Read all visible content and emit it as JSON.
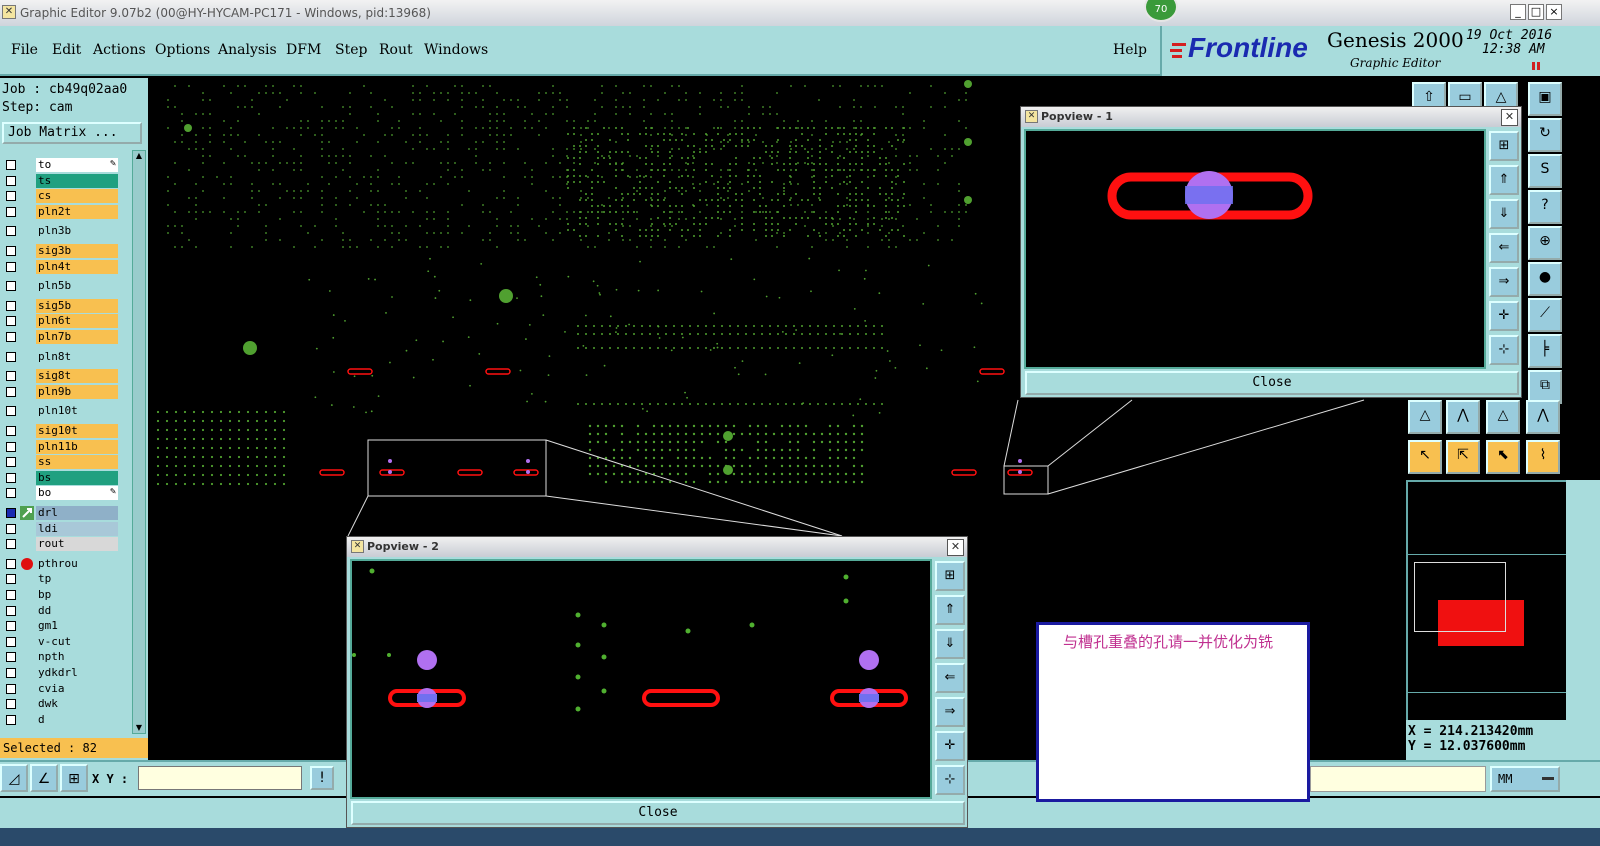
{
  "window": {
    "title": "Graphic Editor 9.07b2 (00@HY-HYCAM-PC171 - Windows, pid:13968)",
    "badge": "70",
    "minimize": "_",
    "maximize": "□",
    "close": "×"
  },
  "menu": {
    "items": [
      "File",
      "Edit",
      "Actions",
      "Options",
      "Analysis",
      "DFM",
      "Step",
      "Rout",
      "Windows"
    ],
    "help": "Help"
  },
  "brand": {
    "logo": "Frontline",
    "product": "Genesis 2000",
    "subtitle": "Graphic Editor",
    "date": "19 Oct 2016",
    "time": "12:38 AM"
  },
  "job": {
    "job_line": "Job : cb49q02aa0",
    "step_line": "Step: cam",
    "matrix_button": "Job Matrix ..."
  },
  "layers": [
    {
      "name": "to",
      "color": "#ffffff",
      "mark": "✎"
    },
    {
      "name": "ts",
      "color": "#20a080"
    },
    {
      "name": "cs",
      "color": "#f8c050"
    },
    {
      "name": "pln2t",
      "color": "#f8c050"
    },
    {
      "name": "pln3b",
      "color": "#a8dcdc"
    },
    {
      "name": "sig3b",
      "color": "#f8c050"
    },
    {
      "name": "pln4t",
      "color": "#f8c050"
    },
    {
      "name": "pln5b",
      "color": "#a8dcdc"
    },
    {
      "name": "sig5b",
      "color": "#f8c050"
    },
    {
      "name": "pln6t",
      "color": "#f8c050"
    },
    {
      "name": "pln7b",
      "color": "#f8c050"
    },
    {
      "name": "pln8t",
      "color": "#a8dcdc"
    },
    {
      "name": "sig8t",
      "color": "#f8c050"
    },
    {
      "name": "pln9b",
      "color": "#f8c050"
    },
    {
      "name": "pln10t",
      "color": "#a8dcdc"
    },
    {
      "name": "sig10t",
      "color": "#f8c050"
    },
    {
      "name": "pln11b",
      "color": "#f8c050"
    },
    {
      "name": "ss",
      "color": "#f8c050"
    },
    {
      "name": "bs",
      "color": "#20a080"
    },
    {
      "name": "bo",
      "color": "#ffffff",
      "mark": "✎"
    },
    {
      "name": "drl",
      "color": "#8fb0c8"
    },
    {
      "name": "ldi",
      "color": "#a8c8d8"
    },
    {
      "name": "rout",
      "color": "#d8d8d8"
    },
    {
      "name": "pthrou",
      "color": "#a8dcdc"
    },
    {
      "name": "tp",
      "color": "#a8dcdc"
    },
    {
      "name": "bp",
      "color": "#a8dcdc"
    },
    {
      "name": "dd",
      "color": "#a8dcdc"
    },
    {
      "name": "gm1",
      "color": "#a8dcdc"
    },
    {
      "name": "v-cut",
      "color": "#a8dcdc"
    },
    {
      "name": "npth",
      "color": "#a8dcdc"
    },
    {
      "name": "ydkdrl",
      "color": "#a8dcdc"
    },
    {
      "name": "cvia",
      "color": "#a8dcdc"
    },
    {
      "name": "dwk",
      "color": "#a8dcdc"
    },
    {
      "name": "d",
      "color": "#a8dcdc"
    }
  ],
  "selected": "Selected : 82",
  "bottom": {
    "xy_label": "X Y :",
    "xy_value": "",
    "units": "MM"
  },
  "popview1": {
    "title": "Popview - 1",
    "close": "Close"
  },
  "popview2": {
    "title": "Popview - 2",
    "close": "Close"
  },
  "note": "与槽孔重叠的孔请一并优化为铣",
  "coords": {
    "x": "X = 214.213420mm",
    "y": "Y = 12.037600mm"
  },
  "colors": {
    "panel": "#a8dcdc",
    "slot": "#ff1010",
    "hole": "#b070f0",
    "pad": "#50b030"
  }
}
